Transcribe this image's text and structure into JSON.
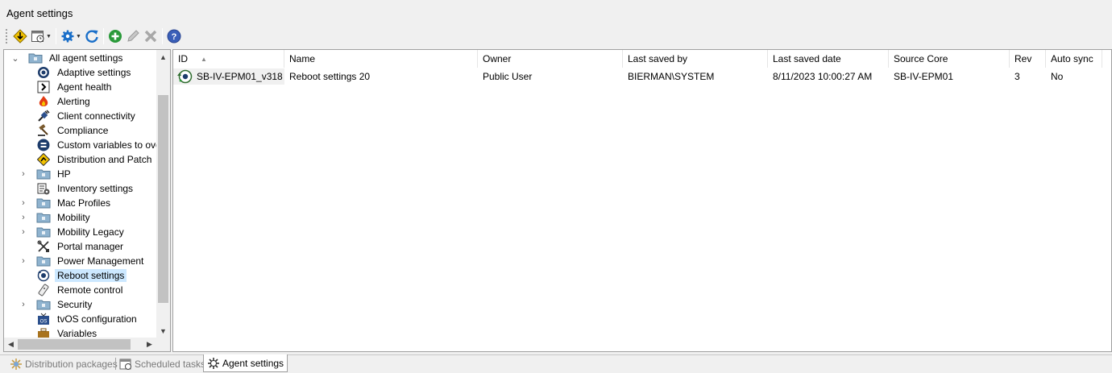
{
  "window": {
    "title": "Agent settings"
  },
  "toolbar": {
    "buttons": [
      {
        "name": "download-icon",
        "dropdown": false
      },
      {
        "name": "schedule-icon",
        "dropdown": true
      },
      {
        "name": "gear-icon",
        "dropdown": true
      },
      {
        "name": "refresh-icon",
        "dropdown": false
      },
      {
        "name": "add-icon",
        "dropdown": false
      },
      {
        "name": "edit-icon",
        "dropdown": false
      },
      {
        "name": "delete-icon",
        "dropdown": false
      },
      {
        "name": "help-icon",
        "dropdown": false
      }
    ]
  },
  "tree": {
    "root": {
      "label": "All agent settings",
      "icon": "folder-icon"
    },
    "items": [
      {
        "label": "Adaptive settings",
        "icon": "adaptive-gear-icon",
        "expandable": false
      },
      {
        "label": "Agent health",
        "icon": "agent-health-icon",
        "expandable": false
      },
      {
        "label": "Alerting",
        "icon": "alert-flame-icon",
        "expandable": false
      },
      {
        "label": "Client connectivity",
        "icon": "plug-icon",
        "expandable": false
      },
      {
        "label": "Compliance",
        "icon": "gavel-icon",
        "expandable": false
      },
      {
        "label": "Custom variables to overri",
        "icon": "equals-icon",
        "expandable": false
      },
      {
        "label": "Distribution and Patch",
        "icon": "diamond-sign-icon",
        "expandable": false
      },
      {
        "label": "HP",
        "icon": "folder-icon",
        "expandable": true
      },
      {
        "label": "Inventory settings",
        "icon": "inventory-icon",
        "expandable": false
      },
      {
        "label": "Mac Profiles",
        "icon": "folder-icon",
        "expandable": true
      },
      {
        "label": "Mobility",
        "icon": "folder-icon",
        "expandable": true
      },
      {
        "label": "Mobility Legacy",
        "icon": "folder-icon",
        "expandable": true
      },
      {
        "label": "Portal manager",
        "icon": "portal-tools-icon",
        "expandable": false
      },
      {
        "label": "Power Management",
        "icon": "folder-icon",
        "expandable": true
      },
      {
        "label": "Reboot settings",
        "icon": "reboot-icon",
        "expandable": false,
        "selected": true
      },
      {
        "label": "Remote control",
        "icon": "remote-control-icon",
        "expandable": false
      },
      {
        "label": "Security",
        "icon": "folder-icon",
        "expandable": true
      },
      {
        "label": "tvOS configuration",
        "icon": "tv-icon",
        "expandable": false
      },
      {
        "label": "Variables",
        "icon": "briefcase-icon",
        "expandable": false
      }
    ]
  },
  "grid": {
    "columns": [
      "ID",
      "Name",
      "Owner",
      "Last saved by",
      "Last saved date",
      "Source Core",
      "Rev",
      "Auto sync"
    ],
    "sort_column": "ID",
    "rows": [
      {
        "id": "SB-IV-EPM01_v318",
        "name": "Reboot settings 20",
        "owner": "Public User",
        "last_saved_by": "BIERMAN\\SYSTEM",
        "last_saved_date": "8/11/2023 10:00:27 AM",
        "source_core": "SB-IV-EPM01",
        "rev": "3",
        "auto_sync": "No"
      }
    ]
  },
  "tabs": [
    {
      "label": "Distribution packages",
      "icon": "package-icon",
      "active": false
    },
    {
      "label": "Scheduled tasks",
      "icon": "scheduled-tasks-icon",
      "active": false
    },
    {
      "label": "Agent settings",
      "icon": "agent-settings-icon",
      "active": true
    }
  ],
  "colors": {
    "selection": "#cce8ff",
    "accent_blue": "#1a6fc9",
    "add_green": "#2a9a3a",
    "panel_border": "#a0a0a0"
  }
}
